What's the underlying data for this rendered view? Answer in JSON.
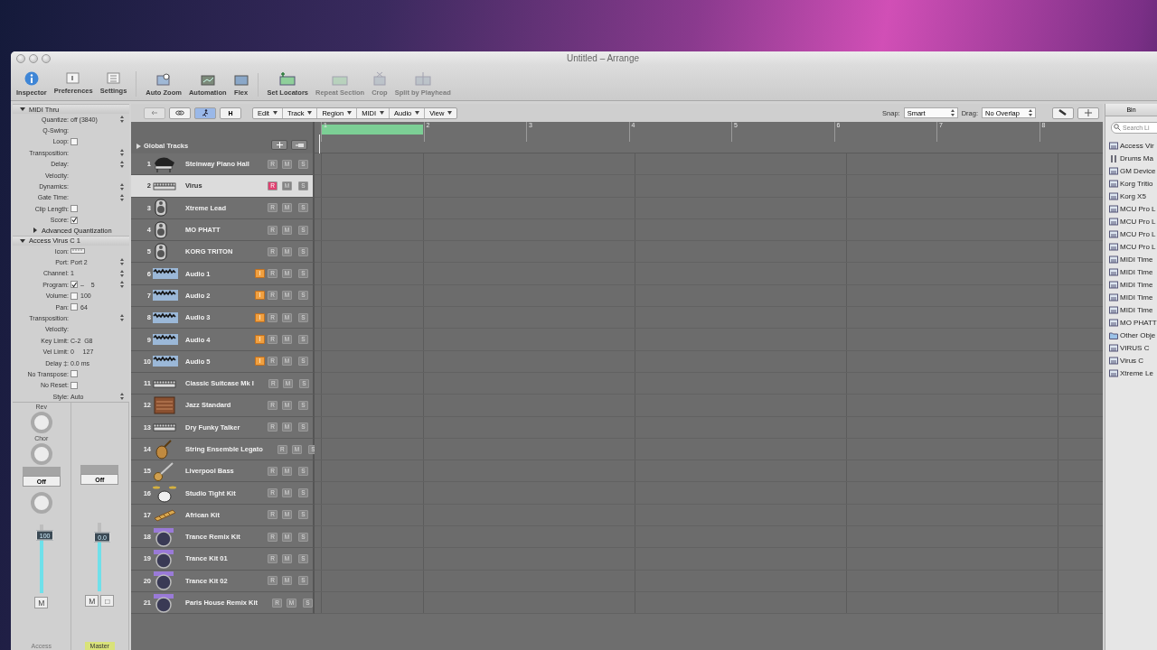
{
  "window": {
    "title": "Untitled – Arrange"
  },
  "toolbar_groups": [
    [
      {
        "label": "Inspector",
        "disabled": false
      },
      {
        "label": "Preferences",
        "disabled": false
      },
      {
        "label": "Settings",
        "disabled": false
      }
    ],
    [
      {
        "label": "Auto Zoom",
        "disabled": false
      },
      {
        "label": "Automation",
        "disabled": false
      },
      {
        "label": "Flex",
        "disabled": false
      }
    ],
    [
      {
        "label": "Set Locators",
        "disabled": false
      },
      {
        "label": "Repeat Section",
        "disabled": true
      },
      {
        "label": "Crop",
        "disabled": true
      },
      {
        "label": "Split by Playhead",
        "disabled": true
      }
    ]
  ],
  "arrange_bar": {
    "tools": [
      {
        "kind": "back",
        "selected": false,
        "disabled": true
      },
      {
        "kind": "link",
        "selected": false,
        "disabled": false
      },
      {
        "kind": "catch",
        "selected": true,
        "disabled": false
      },
      {
        "kind": "text",
        "label": "H",
        "selected": false,
        "disabled": false
      }
    ],
    "menus": [
      "Edit",
      "Track",
      "Region",
      "MIDI",
      "Audio",
      "View"
    ],
    "snap": {
      "label": "Snap:",
      "value": "Smart"
    },
    "drag": {
      "label": "Drag:",
      "value": "No Overlap"
    }
  },
  "inspector": {
    "sections": [
      {
        "kind": "header",
        "title": "MIDI Thru",
        "expanded": true,
        "params": [
          {
            "label": "Quantize:",
            "value": "off (3840)",
            "popup": true
          },
          {
            "label": "Q-Swing:"
          },
          {
            "label": "Loop:",
            "checked": false
          },
          {
            "label": "Transposition:",
            "popup": true
          },
          {
            "label": "Delay:",
            "popup": true
          },
          {
            "label": "Velocity:"
          },
          {
            "label": "Dynamics:",
            "popup": true
          },
          {
            "label": "Gate Time:",
            "popup": true
          },
          {
            "label": "Clip Length:",
            "checked": false
          },
          {
            "label": "Score:",
            "checked": true
          }
        ]
      },
      {
        "kind": "sub",
        "title": "Advanced Quantization",
        "expanded": false
      },
      {
        "kind": "header",
        "title": "Access Virus C  1",
        "expanded": true,
        "params": [
          {
            "label": "Icon:",
            "icon": true
          },
          {
            "label": "Port:",
            "value": "Port 2",
            "popup": true
          },
          {
            "label": "Channel:",
            "value": "1",
            "popup": true
          },
          {
            "label": "Program:",
            "checked": true,
            "value": "–    5",
            "popup": true
          },
          {
            "label": "Volume:",
            "checked": false,
            "value": "100"
          },
          {
            "label": "Pan:",
            "checked": false,
            "value": "64"
          },
          {
            "label": "Transposition:",
            "popup": true
          },
          {
            "label": "Velocity:"
          },
          {
            "label": "Key Limit:",
            "value": "C-2  G8"
          },
          {
            "label": "Vel Limit:",
            "value": "0     127"
          },
          {
            "label": "Delay ‡:",
            "value": "0.0 ms"
          },
          {
            "label": "No Transpose:",
            "checked": false
          },
          {
            "label": "No Reset:",
            "checked": false
          },
          {
            "label": "Style:",
            "value": "Auto",
            "popup": true
          }
        ]
      }
    ],
    "strips": [
      {
        "sends": [
          "Rev",
          "Chor"
        ],
        "slot": "Off",
        "pan_knob": true,
        "fader": "100",
        "level": 0.85,
        "buttons": [
          "M"
        ],
        "name": "Access",
        "selected": false
      },
      {
        "slot": "Off",
        "pan_knob": false,
        "fader": "0.0",
        "level": 0.8,
        "buttons": [
          "M",
          "□"
        ],
        "name": "Master",
        "selected": true
      }
    ]
  },
  "global_tracks": {
    "label": "Global Tracks"
  },
  "tracks": [
    {
      "number": "1",
      "name": "Steinway Piano Hall",
      "kind": "piano",
      "selected": false,
      "armed": false,
      "record": "R",
      "mute": "M",
      "solo": "S"
    },
    {
      "number": "2",
      "name": "Virus",
      "kind": "keys",
      "selected": true,
      "armed": true,
      "record": "R",
      "mute": "M",
      "solo": "S"
    },
    {
      "number": "3",
      "name": "Xtreme Lead",
      "kind": "mic",
      "selected": false,
      "armed": false,
      "record": "R",
      "mute": "M",
      "solo": "S"
    },
    {
      "number": "4",
      "name": "MO PHATT",
      "kind": "mic",
      "selected": false,
      "armed": false,
      "record": "R",
      "mute": "M",
      "solo": "S"
    },
    {
      "number": "5",
      "name": "KORG TRITON",
      "kind": "mic",
      "selected": false,
      "armed": false,
      "record": "R",
      "mute": "M",
      "solo": "S"
    },
    {
      "number": "6",
      "name": "Audio 1",
      "kind": "audio",
      "selected": false,
      "armed": false,
      "input": "I",
      "record": "R",
      "mute": "M",
      "solo": "S"
    },
    {
      "number": "7",
      "name": "Audio 2",
      "kind": "audio",
      "selected": false,
      "armed": false,
      "input": "I",
      "record": "R",
      "mute": "M",
      "solo": "S"
    },
    {
      "number": "8",
      "name": "Audio 3",
      "kind": "audio",
      "selected": false,
      "armed": false,
      "input": "I",
      "record": "R",
      "mute": "M",
      "solo": "S"
    },
    {
      "number": "9",
      "name": "Audio 4",
      "kind": "audio",
      "selected": false,
      "armed": false,
      "input": "I",
      "record": "R",
      "mute": "M",
      "solo": "S"
    },
    {
      "number": "10",
      "name": "Audio 5",
      "kind": "audio",
      "selected": false,
      "armed": false,
      "input": "I",
      "record": "R",
      "mute": "M",
      "solo": "S"
    },
    {
      "number": "11",
      "name": "Classic Suitcase Mk I",
      "kind": "keys",
      "selected": false,
      "armed": false,
      "record": "R",
      "mute": "M",
      "solo": "S"
    },
    {
      "number": "12",
      "name": "Jazz Standard",
      "kind": "organ",
      "selected": false,
      "armed": false,
      "record": "R",
      "mute": "M",
      "solo": "S"
    },
    {
      "number": "13",
      "name": "Dry Funky Talker",
      "kind": "keys",
      "selected": false,
      "armed": false,
      "record": "R",
      "mute": "M",
      "solo": "S"
    },
    {
      "number": "14",
      "name": "String Ensemble Legato",
      "kind": "violin",
      "selected": false,
      "armed": false,
      "record": "R",
      "mute": "M",
      "solo": "S"
    },
    {
      "number": "15",
      "name": "Liverpool Bass",
      "kind": "guitar",
      "selected": false,
      "armed": false,
      "record": "R",
      "mute": "M",
      "solo": "S"
    },
    {
      "number": "16",
      "name": "Studio Tight Kit",
      "kind": "drums",
      "selected": false,
      "armed": false,
      "record": "R",
      "mute": "M",
      "solo": "S"
    },
    {
      "number": "17",
      "name": "African Kit",
      "kind": "marimba",
      "selected": false,
      "armed": false,
      "record": "R",
      "mute": "M",
      "solo": "S"
    },
    {
      "number": "18",
      "name": "Trance Remix Kit",
      "kind": "pad",
      "selected": false,
      "armed": false,
      "record": "R",
      "mute": "M",
      "solo": "S"
    },
    {
      "number": "19",
      "name": "Trance Kit 01",
      "kind": "pad",
      "selected": false,
      "armed": false,
      "record": "R",
      "mute": "M",
      "solo": "S"
    },
    {
      "number": "20",
      "name": "Trance Kit 02",
      "kind": "pad",
      "selected": false,
      "armed": false,
      "record": "R",
      "mute": "M",
      "solo": "S"
    },
    {
      "number": "21",
      "name": "Paris House Remix Kit",
      "kind": "pad",
      "selected": false,
      "armed": false,
      "record": "R",
      "mute": "M",
      "solo": "S"
    }
  ],
  "ruler": {
    "bars": [
      "1",
      "2",
      "3",
      "4",
      "5",
      "6",
      "7",
      "8"
    ],
    "cycle_on": true
  },
  "bin": {
    "tab": "Bin",
    "placeholder": "Search Li",
    "items": [
      {
        "name": "Access Vir",
        "kind": "instrument"
      },
      {
        "name": "Drums Ma",
        "kind": "drums"
      },
      {
        "name": "GM Device",
        "kind": "instrument"
      },
      {
        "name": "Korg Tritio",
        "kind": "instrument"
      },
      {
        "name": "Korg X5",
        "kind": "instrument"
      },
      {
        "name": "MCU Pro L",
        "kind": "instrument"
      },
      {
        "name": "MCU Pro L",
        "kind": "instrument"
      },
      {
        "name": "MCU Pro L",
        "kind": "instrument"
      },
      {
        "name": "MCU Pro L",
        "kind": "instrument"
      },
      {
        "name": "MIDI Time",
        "kind": "instrument"
      },
      {
        "name": "MIDI Time",
        "kind": "instrument"
      },
      {
        "name": "MIDI Time",
        "kind": "instrument"
      },
      {
        "name": "MIDI Time",
        "kind": "instrument"
      },
      {
        "name": "MIDI Time",
        "kind": "instrument"
      },
      {
        "name": "MO PHATT",
        "kind": "instrument"
      },
      {
        "name": "Other Obje",
        "kind": "folder"
      },
      {
        "name": "VIRUS C",
        "kind": "instrument"
      },
      {
        "name": "Virus C",
        "kind": "instrument"
      },
      {
        "name": "Xtreme Le",
        "kind": "instrument"
      }
    ]
  }
}
